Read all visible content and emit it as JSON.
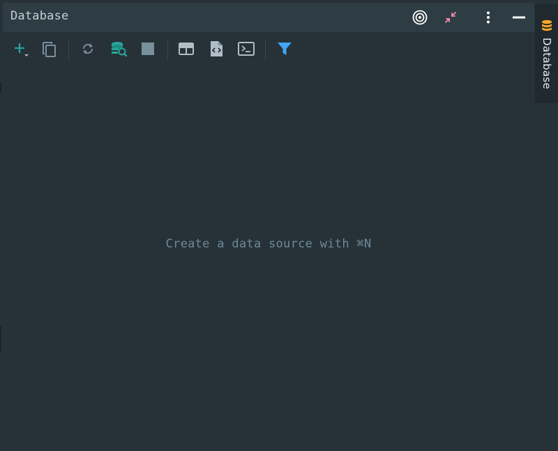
{
  "tool_window": {
    "title": "Database",
    "actions": {
      "locate_icon": "target-icon",
      "collapse_icon": "collapse-arrows-icon",
      "options_icon": "more-vertical-icon",
      "hide_icon": "minimize-icon"
    }
  },
  "toolbar": {
    "items": [
      {
        "name": "new",
        "icon": "plus-dropdown-icon"
      },
      {
        "name": "duplicate",
        "icon": "copy-icon"
      },
      {
        "name": "refresh",
        "icon": "refresh-icon"
      },
      {
        "name": "schema_filter",
        "icon": "database-search-icon"
      },
      {
        "name": "stop",
        "icon": "stop-icon"
      },
      {
        "name": "table_editor",
        "icon": "table-icon"
      },
      {
        "name": "ddl",
        "icon": "ddl-file-icon"
      },
      {
        "name": "console",
        "icon": "console-icon"
      },
      {
        "name": "filter",
        "icon": "filter-icon"
      }
    ]
  },
  "main": {
    "empty_message": "Create a data source with ⌘N"
  },
  "right_stripe": {
    "label": "Database",
    "icon": "database-icon"
  },
  "colors": {
    "background": "#263238",
    "title_bar": "#2e3c43",
    "accent_teal": "#26a69a",
    "accent_blue": "#42a5f5",
    "accent_pink": "#f48fb1",
    "database_orange": "#ffa726",
    "empty_text": "#6e8a97"
  }
}
